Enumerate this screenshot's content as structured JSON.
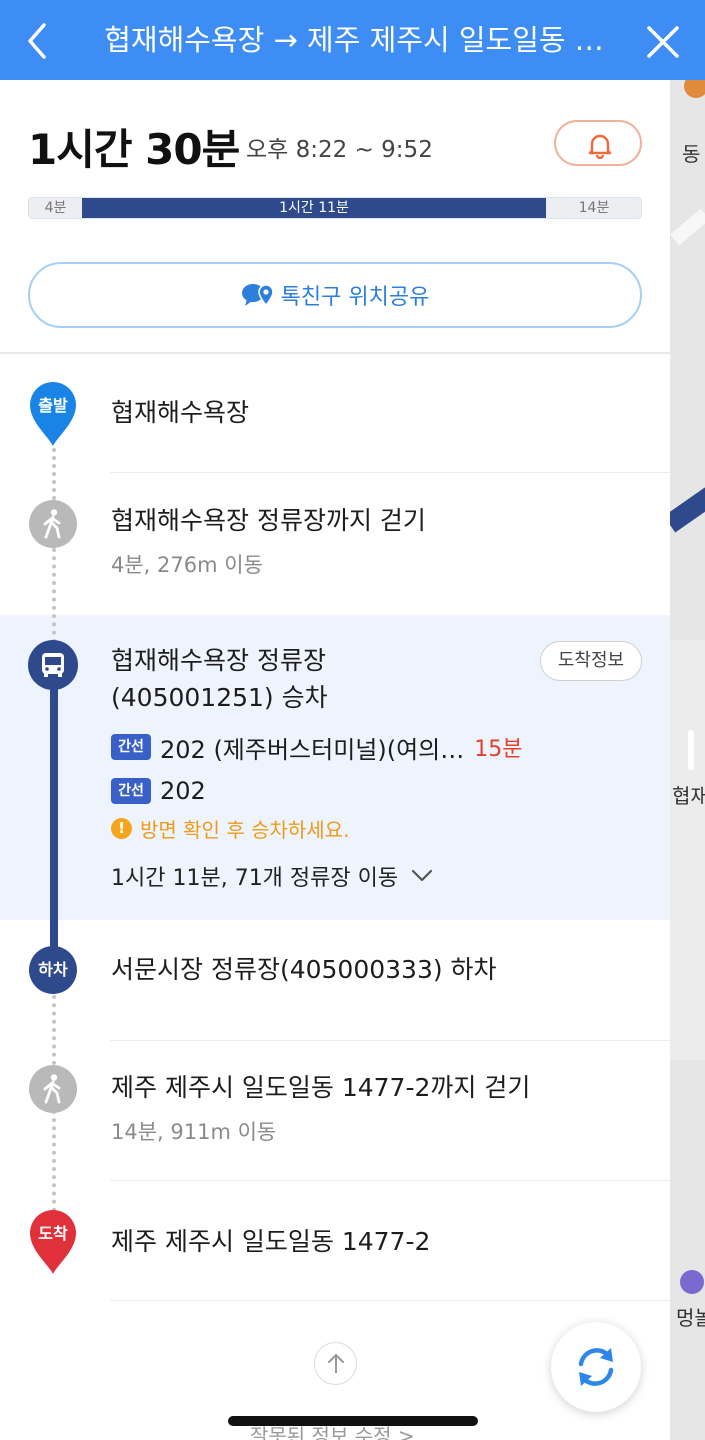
{
  "header": {
    "title": "협재해수욕장 → 제주 제주시 일도일동 …",
    "back_icon": "chevron-left-icon",
    "close_icon": "close-icon",
    "bg_color": "#3d8df5"
  },
  "summary": {
    "duration": "1시간 30분",
    "time_range": "오후 8:22 ~ 9:52",
    "alarm_icon": "bell-icon",
    "segments": [
      {
        "label": "4분",
        "kind": "walk"
      },
      {
        "label": "1시간 11분",
        "kind": "bus"
      },
      {
        "label": "14분",
        "kind": "walk"
      }
    ],
    "share_label": "톡친구 위치공유",
    "share_icon": "location-chat-icon"
  },
  "steps": {
    "start": {
      "badge": "출발",
      "title": "협재해수욕장"
    },
    "walk1": {
      "title": "협재해수욕장 정류장까지 걷기",
      "sub": "4분, 276m 이동"
    },
    "board": {
      "title_line1": "협재해수욕장 정류장",
      "title_line2": "(405001251) 승차",
      "arrival_button": "도착정보",
      "buses": [
        {
          "type": "간선",
          "name": "202 (제주버스터미널)(여의…",
          "arrival": "15분"
        },
        {
          "type": "간선",
          "name": "202",
          "arrival": ""
        }
      ],
      "warning": "방면 확인 후 승차하세요.",
      "stops_summary": "1시간 11분, 71개 정류장 이동"
    },
    "alight": {
      "badge": "하차",
      "title": "서문시장 정류장(405000333) 하차"
    },
    "walk2": {
      "title": "제주 제주시 일도일동 1477-2까지 걷기",
      "sub": "14분, 911m 이동"
    },
    "end": {
      "badge": "도착",
      "title": "제주 제주시 일도일동 1477-2"
    }
  },
  "footer": {
    "report_label": "잘못된 정보 수정 >",
    "scroll_up_icon": "arrow-up-icon",
    "refresh_icon": "refresh-icon"
  },
  "map": {
    "labels": [
      "동",
      "협재",
      "멍놀"
    ]
  },
  "colors": {
    "bus_line": "#2f4a8c",
    "start_pin": "#1a84e6",
    "end_pin": "#e0303a",
    "highlight": "#eef4fd",
    "arrival_red": "#e5402b",
    "warning_orange": "#ef9a16"
  }
}
